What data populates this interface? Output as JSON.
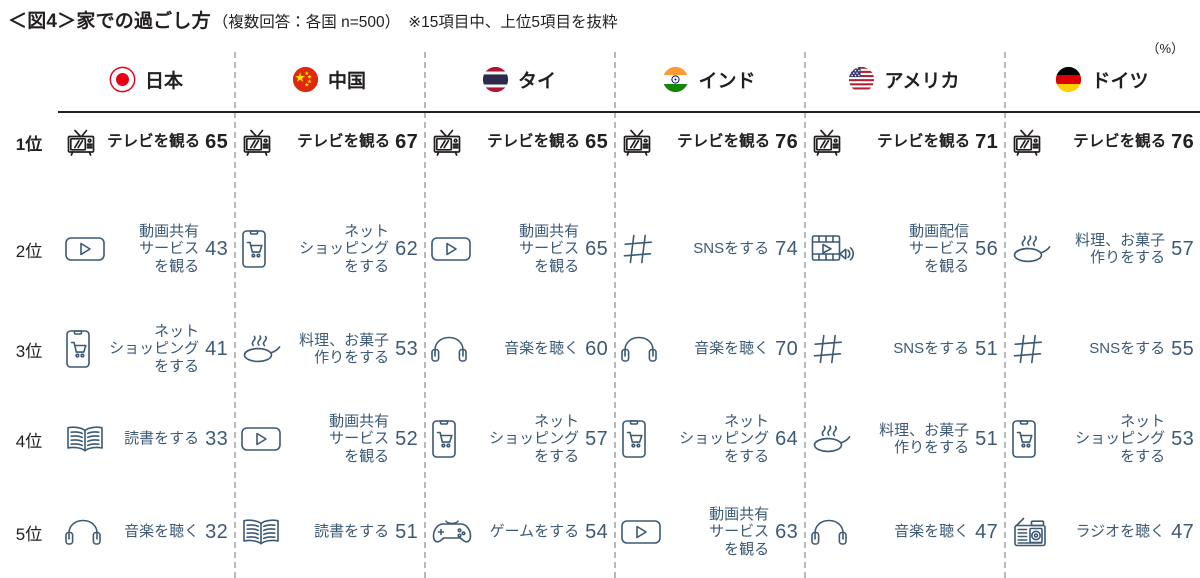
{
  "header": {
    "title_main": "＜図4＞家での過ごし方",
    "title_sub": "（複数回答：各国  n=500）",
    "title_note": "※15項目中、上位5項目を抜粋",
    "unit": "（%）"
  },
  "countries": [
    {
      "name": "日本",
      "flag": "flag-japan"
    },
    {
      "name": "中国",
      "flag": "flag-china"
    },
    {
      "name": "タイ",
      "flag": "flag-thailand"
    },
    {
      "name": "インド",
      "flag": "flag-india"
    },
    {
      "name": "アメリカ",
      "flag": "flag-usa"
    },
    {
      "name": "ドイツ",
      "flag": "flag-germany"
    }
  ],
  "ranks": [
    "1位",
    "2位",
    "3位",
    "4位",
    "5位"
  ],
  "colors": {
    "accent_text": "#3c5a75",
    "dark_text": "#231f20",
    "separator": "#b9b9b9",
    "row1_rule": "#231f20"
  },
  "chart_data": {
    "type": "table",
    "title": "＜図4＞家での過ごし方",
    "subtitle": "（複数回答：各国  n=500）※15項目中、上位5項目を抜粋",
    "unit": "%",
    "row_headers": [
      "1位",
      "2位",
      "3位",
      "4位",
      "5位"
    ],
    "column_headers": [
      "日本",
      "中国",
      "タイ",
      "インド",
      "アメリカ",
      "ドイツ"
    ],
    "cells": [
      [
        {
          "label": "テレビを観る",
          "value": 65,
          "icon": "tv-icon"
        },
        {
          "label": "テレビを観る",
          "value": 67,
          "icon": "tv-icon"
        },
        {
          "label": "テレビを観る",
          "value": 65,
          "icon": "tv-icon"
        },
        {
          "label": "テレビを観る",
          "value": 76,
          "icon": "tv-icon"
        },
        {
          "label": "テレビを観る",
          "value": 71,
          "icon": "tv-icon"
        },
        {
          "label": "テレビを観る",
          "value": 76,
          "icon": "tv-icon"
        }
      ],
      [
        {
          "label": "動画共有\nサービス\nを観る",
          "value": 43,
          "icon": "video-play-icon"
        },
        {
          "label": "ネット\nショッピング\nをする",
          "value": 62,
          "icon": "online-shopping-icon"
        },
        {
          "label": "動画共有\nサービス\nを観る",
          "value": 65,
          "icon": "video-play-icon"
        },
        {
          "label": "SNSをする",
          "value": 74,
          "icon": "hashtag-icon"
        },
        {
          "label": "動画配信\nサービス\nを観る",
          "value": 56,
          "icon": "video-streaming-icon"
        },
        {
          "label": "料理、お菓子\n作りをする",
          "value": 57,
          "icon": "cooking-pan-icon"
        }
      ],
      [
        {
          "label": "ネット\nショッピング\nをする",
          "value": 41,
          "icon": "online-shopping-icon"
        },
        {
          "label": "料理、お菓子\n作りをする",
          "value": 53,
          "icon": "cooking-pan-icon"
        },
        {
          "label": "音楽を聴く",
          "value": 60,
          "icon": "headphones-icon"
        },
        {
          "label": "音楽を聴く",
          "value": 70,
          "icon": "headphones-icon"
        },
        {
          "label": "SNSをする",
          "value": 51,
          "icon": "hashtag-icon"
        },
        {
          "label": "SNSをする",
          "value": 55,
          "icon": "hashtag-icon"
        }
      ],
      [
        {
          "label": "読書をする",
          "value": 33,
          "icon": "book-icon"
        },
        {
          "label": "動画共有\nサービス\nを観る",
          "value": 52,
          "icon": "video-play-icon"
        },
        {
          "label": "ネット\nショッピング\nをする",
          "value": 57,
          "icon": "online-shopping-icon"
        },
        {
          "label": "ネット\nショッピング\nをする",
          "value": 64,
          "icon": "online-shopping-icon"
        },
        {
          "label": "料理、お菓子\n作りをする",
          "value": 51,
          "icon": "cooking-pan-icon"
        },
        {
          "label": "ネット\nショッピング\nをする",
          "value": 53,
          "icon": "online-shopping-icon"
        }
      ],
      [
        {
          "label": "音楽を聴く",
          "value": 32,
          "icon": "headphones-icon"
        },
        {
          "label": "読書をする",
          "value": 51,
          "icon": "book-icon"
        },
        {
          "label": "ゲームをする",
          "value": 54,
          "icon": "gamepad-icon"
        },
        {
          "label": "動画共有\nサービス\nを観る",
          "value": 63,
          "icon": "video-play-icon"
        },
        {
          "label": "音楽を聴く",
          "value": 47,
          "icon": "headphones-icon"
        },
        {
          "label": "ラジオを聴く",
          "value": 47,
          "icon": "radio-icon"
        }
      ]
    ]
  }
}
